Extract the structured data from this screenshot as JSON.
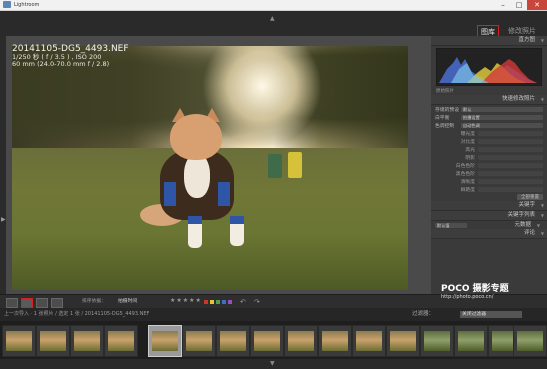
{
  "window": {
    "title": "Lightroom"
  },
  "modules": [
    {
      "label": "图库",
      "active": true
    },
    {
      "label": "修改照片",
      "active": false
    }
  ],
  "photo_info": {
    "filename": "20141105-DG5_4493.NEF",
    "exposure": "1/250 秒 ( f / 3.5 ) , ISO 200",
    "lens": "60 mm (24.0-70.0 mm f / 2.8)"
  },
  "right_panel": {
    "histogram_title": "直方图",
    "histogram_info": "原始照片",
    "quick_develop_title": "快速修改照片",
    "rows": [
      {
        "label": "存储的预设",
        "value": "默认"
      },
      {
        "label": "白平衡",
        "value": "拍摄设置"
      },
      {
        "label": "色调控制",
        "value": "自动色调"
      }
    ],
    "sub_rows": [
      {
        "label": "曝光度",
        "value": ""
      },
      {
        "label": "对比度",
        "value": ""
      },
      {
        "label": "高光",
        "value": ""
      },
      {
        "label": "阴影",
        "value": ""
      },
      {
        "label": "白色色阶",
        "value": ""
      },
      {
        "label": "黑色色阶",
        "value": ""
      },
      {
        "label": "清晰度",
        "value": ""
      },
      {
        "label": "鲜艳度",
        "value": ""
      }
    ],
    "reset_button": "全部重置",
    "keywords_title": "关键字",
    "keyword_list_title": "关键字列表",
    "metadata_title": "元数据",
    "metadata_value": "默认值",
    "comments_title": "评论"
  },
  "toolbar": {
    "sort_label": "排序依据：",
    "sort_value": "拍摄时间",
    "stars": "★★★★★"
  },
  "watermark": {
    "brand": "POCO 摄影专题",
    "url": "http://photo.poco.cn/"
  },
  "pathbar": {
    "path": "上一次导入 · 1 张照片 / 选定 1 张 / 20141105-DG5_4493.NEF",
    "filter_label": "过滤器：",
    "filter_value": "关闭过滤器"
  },
  "colors": {
    "accent": "#d62020",
    "labels": [
      "#d0342c",
      "#e1c537",
      "#4aa04a",
      "#3f6fc4",
      "#9a4fc0"
    ]
  }
}
